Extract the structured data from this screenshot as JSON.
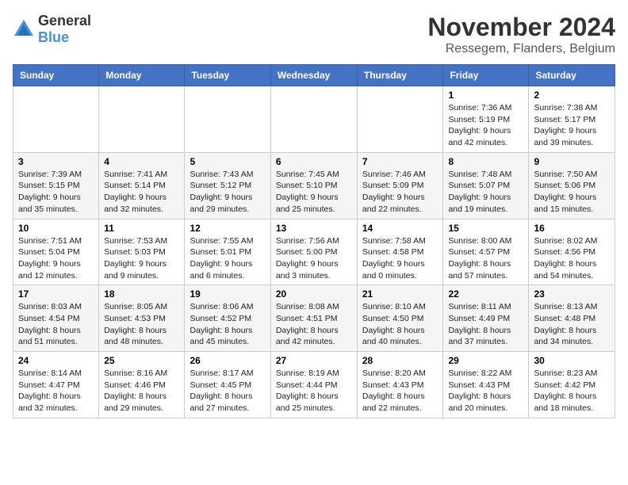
{
  "logo": {
    "general": "General",
    "blue": "Blue"
  },
  "title": "November 2024",
  "location": "Ressegem, Flanders, Belgium",
  "days_of_week": [
    "Sunday",
    "Monday",
    "Tuesday",
    "Wednesday",
    "Thursday",
    "Friday",
    "Saturday"
  ],
  "weeks": [
    [
      {
        "day": "",
        "sunrise": "",
        "sunset": "",
        "daylight": ""
      },
      {
        "day": "",
        "sunrise": "",
        "sunset": "",
        "daylight": ""
      },
      {
        "day": "",
        "sunrise": "",
        "sunset": "",
        "daylight": ""
      },
      {
        "day": "",
        "sunrise": "",
        "sunset": "",
        "daylight": ""
      },
      {
        "day": "",
        "sunrise": "",
        "sunset": "",
        "daylight": ""
      },
      {
        "day": "1",
        "sunrise": "Sunrise: 7:36 AM",
        "sunset": "Sunset: 5:19 PM",
        "daylight": "Daylight: 9 hours and 42 minutes."
      },
      {
        "day": "2",
        "sunrise": "Sunrise: 7:38 AM",
        "sunset": "Sunset: 5:17 PM",
        "daylight": "Daylight: 9 hours and 39 minutes."
      }
    ],
    [
      {
        "day": "3",
        "sunrise": "Sunrise: 7:39 AM",
        "sunset": "Sunset: 5:15 PM",
        "daylight": "Daylight: 9 hours and 35 minutes."
      },
      {
        "day": "4",
        "sunrise": "Sunrise: 7:41 AM",
        "sunset": "Sunset: 5:14 PM",
        "daylight": "Daylight: 9 hours and 32 minutes."
      },
      {
        "day": "5",
        "sunrise": "Sunrise: 7:43 AM",
        "sunset": "Sunset: 5:12 PM",
        "daylight": "Daylight: 9 hours and 29 minutes."
      },
      {
        "day": "6",
        "sunrise": "Sunrise: 7:45 AM",
        "sunset": "Sunset: 5:10 PM",
        "daylight": "Daylight: 9 hours and 25 minutes."
      },
      {
        "day": "7",
        "sunrise": "Sunrise: 7:46 AM",
        "sunset": "Sunset: 5:09 PM",
        "daylight": "Daylight: 9 hours and 22 minutes."
      },
      {
        "day": "8",
        "sunrise": "Sunrise: 7:48 AM",
        "sunset": "Sunset: 5:07 PM",
        "daylight": "Daylight: 9 hours and 19 minutes."
      },
      {
        "day": "9",
        "sunrise": "Sunrise: 7:50 AM",
        "sunset": "Sunset: 5:06 PM",
        "daylight": "Daylight: 9 hours and 15 minutes."
      }
    ],
    [
      {
        "day": "10",
        "sunrise": "Sunrise: 7:51 AM",
        "sunset": "Sunset: 5:04 PM",
        "daylight": "Daylight: 9 hours and 12 minutes."
      },
      {
        "day": "11",
        "sunrise": "Sunrise: 7:53 AM",
        "sunset": "Sunset: 5:03 PM",
        "daylight": "Daylight: 9 hours and 9 minutes."
      },
      {
        "day": "12",
        "sunrise": "Sunrise: 7:55 AM",
        "sunset": "Sunset: 5:01 PM",
        "daylight": "Daylight: 9 hours and 6 minutes."
      },
      {
        "day": "13",
        "sunrise": "Sunrise: 7:56 AM",
        "sunset": "Sunset: 5:00 PM",
        "daylight": "Daylight: 9 hours and 3 minutes."
      },
      {
        "day": "14",
        "sunrise": "Sunrise: 7:58 AM",
        "sunset": "Sunset: 4:58 PM",
        "daylight": "Daylight: 9 hours and 0 minutes."
      },
      {
        "day": "15",
        "sunrise": "Sunrise: 8:00 AM",
        "sunset": "Sunset: 4:57 PM",
        "daylight": "Daylight: 8 hours and 57 minutes."
      },
      {
        "day": "16",
        "sunrise": "Sunrise: 8:02 AM",
        "sunset": "Sunset: 4:56 PM",
        "daylight": "Daylight: 8 hours and 54 minutes."
      }
    ],
    [
      {
        "day": "17",
        "sunrise": "Sunrise: 8:03 AM",
        "sunset": "Sunset: 4:54 PM",
        "daylight": "Daylight: 8 hours and 51 minutes."
      },
      {
        "day": "18",
        "sunrise": "Sunrise: 8:05 AM",
        "sunset": "Sunset: 4:53 PM",
        "daylight": "Daylight: 8 hours and 48 minutes."
      },
      {
        "day": "19",
        "sunrise": "Sunrise: 8:06 AM",
        "sunset": "Sunset: 4:52 PM",
        "daylight": "Daylight: 8 hours and 45 minutes."
      },
      {
        "day": "20",
        "sunrise": "Sunrise: 8:08 AM",
        "sunset": "Sunset: 4:51 PM",
        "daylight": "Daylight: 8 hours and 42 minutes."
      },
      {
        "day": "21",
        "sunrise": "Sunrise: 8:10 AM",
        "sunset": "Sunset: 4:50 PM",
        "daylight": "Daylight: 8 hours and 40 minutes."
      },
      {
        "day": "22",
        "sunrise": "Sunrise: 8:11 AM",
        "sunset": "Sunset: 4:49 PM",
        "daylight": "Daylight: 8 hours and 37 minutes."
      },
      {
        "day": "23",
        "sunrise": "Sunrise: 8:13 AM",
        "sunset": "Sunset: 4:48 PM",
        "daylight": "Daylight: 8 hours and 34 minutes."
      }
    ],
    [
      {
        "day": "24",
        "sunrise": "Sunrise: 8:14 AM",
        "sunset": "Sunset: 4:47 PM",
        "daylight": "Daylight: 8 hours and 32 minutes."
      },
      {
        "day": "25",
        "sunrise": "Sunrise: 8:16 AM",
        "sunset": "Sunset: 4:46 PM",
        "daylight": "Daylight: 8 hours and 29 minutes."
      },
      {
        "day": "26",
        "sunrise": "Sunrise: 8:17 AM",
        "sunset": "Sunset: 4:45 PM",
        "daylight": "Daylight: 8 hours and 27 minutes."
      },
      {
        "day": "27",
        "sunrise": "Sunrise: 8:19 AM",
        "sunset": "Sunset: 4:44 PM",
        "daylight": "Daylight: 8 hours and 25 minutes."
      },
      {
        "day": "28",
        "sunrise": "Sunrise: 8:20 AM",
        "sunset": "Sunset: 4:43 PM",
        "daylight": "Daylight: 8 hours and 22 minutes."
      },
      {
        "day": "29",
        "sunrise": "Sunrise: 8:22 AM",
        "sunset": "Sunset: 4:43 PM",
        "daylight": "Daylight: 8 hours and 20 minutes."
      },
      {
        "day": "30",
        "sunrise": "Sunrise: 8:23 AM",
        "sunset": "Sunset: 4:42 PM",
        "daylight": "Daylight: 8 hours and 18 minutes."
      }
    ]
  ]
}
